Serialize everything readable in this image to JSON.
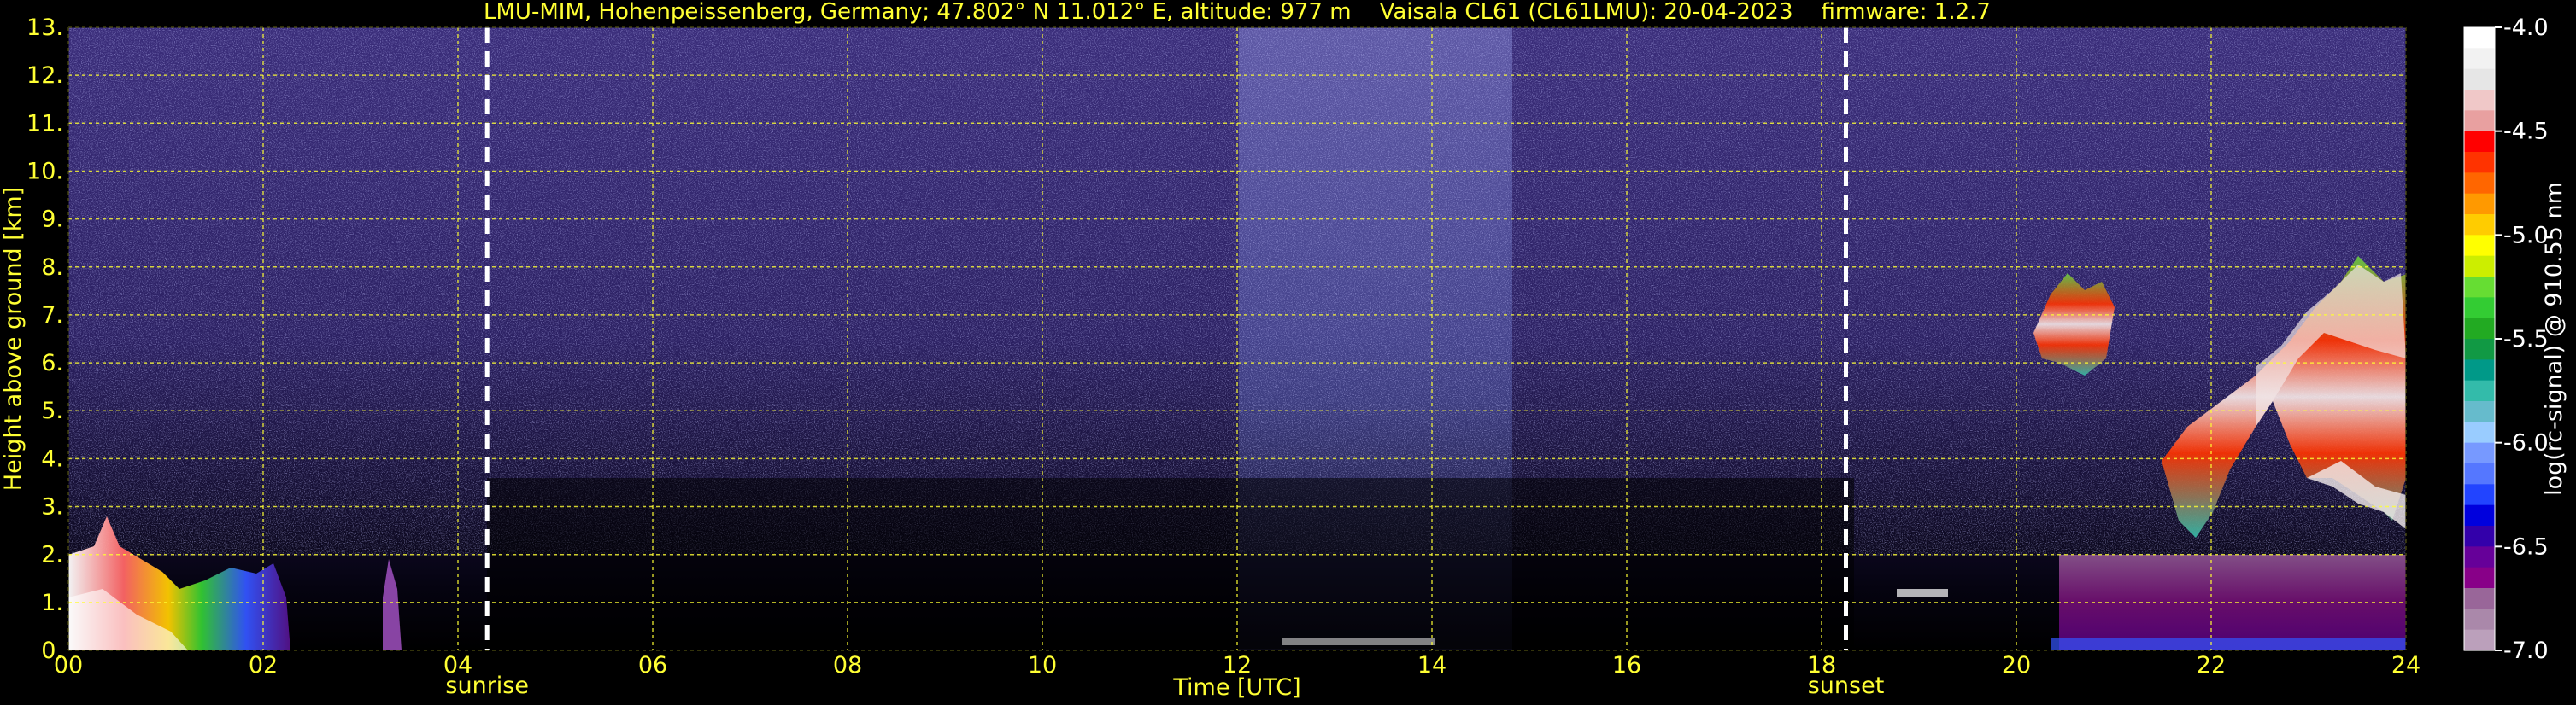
{
  "chart_data": {
    "type": "heatmap",
    "title": "LMU-MIM, Hohenpeissenberg, Germany; 47.802° N 11.012° E, altitude: 977 m    Vaisala CL61 (CL61LMU): 20-04-2023    firmware: 1.2.7",
    "xlabel": "Time [UTC]",
    "ylabel": "Height above ground [km]",
    "x_ticks": [
      "00",
      "02",
      "04",
      "06",
      "08",
      "10",
      "12",
      "14",
      "16",
      "18",
      "20",
      "22",
      "24"
    ],
    "y_ticks": [
      "0.",
      "1.",
      "2.",
      "3.",
      "4.",
      "5.",
      "6.",
      "7.",
      "8.",
      "9.",
      "10.",
      "11.",
      "12.",
      "13."
    ],
    "xlim": [
      0,
      24
    ],
    "ylim": [
      0,
      13
    ],
    "grid": true,
    "grid_color": "#ffff33",
    "events": [
      {
        "label": "sunrise",
        "time": 4.3
      },
      {
        "label": "sunset",
        "time": 18.25
      }
    ],
    "colorbar": {
      "label": "log(rc-signal) @ 910.55 nm",
      "range": [
        -7.0,
        -4.0
      ],
      "ticks": [
        "-4.0",
        "-4.5",
        "-5.0",
        "-5.5",
        "-6.0",
        "-6.5",
        "-7.0"
      ],
      "colors": [
        "#ffffff",
        "#f2f2f2",
        "#e6e6e6",
        "#f0c8c8",
        "#e8a0a0",
        "#ff0000",
        "#ff3300",
        "#ff6600",
        "#ff9900",
        "#ffcc00",
        "#ffff00",
        "#ccee00",
        "#66dd33",
        "#33cc33",
        "#22aa22",
        "#119944",
        "#009988",
        "#33bbaa",
        "#66bbcc",
        "#99ccff",
        "#7799ff",
        "#5577ff",
        "#2244ff",
        "#0000dd",
        "#3300aa",
        "#660099",
        "#880088",
        "#996699",
        "#aa88aa",
        "#bba0bb"
      ],
      "colors_order": "top-to-bottom"
    },
    "features": [
      {
        "name": "low aerosol layer / fog",
        "x_range": [
          0,
          2.3
        ],
        "y_range": [
          0,
          2.9
        ]
      },
      {
        "name": "small plume",
        "x_range": [
          3.2,
          3.5
        ],
        "y_range": [
          0,
          1.9
        ]
      },
      {
        "name": "noise band daytime",
        "x_range": [
          12,
          14.8
        ],
        "y_range": [
          0,
          13
        ]
      },
      {
        "name": "mid-level cloud",
        "x_range": [
          19.3,
          20.4
        ],
        "y_range": [
          5.8,
          7.2
        ]
      },
      {
        "name": "ascending cloud layer",
        "x_range": [
          20.5,
          24
        ],
        "y_range": [
          2.2,
          8.3
        ]
      },
      {
        "name": "boundary layer aerosol",
        "x_range": [
          20.5,
          24
        ],
        "y_range": [
          0,
          2.0
        ]
      }
    ]
  }
}
